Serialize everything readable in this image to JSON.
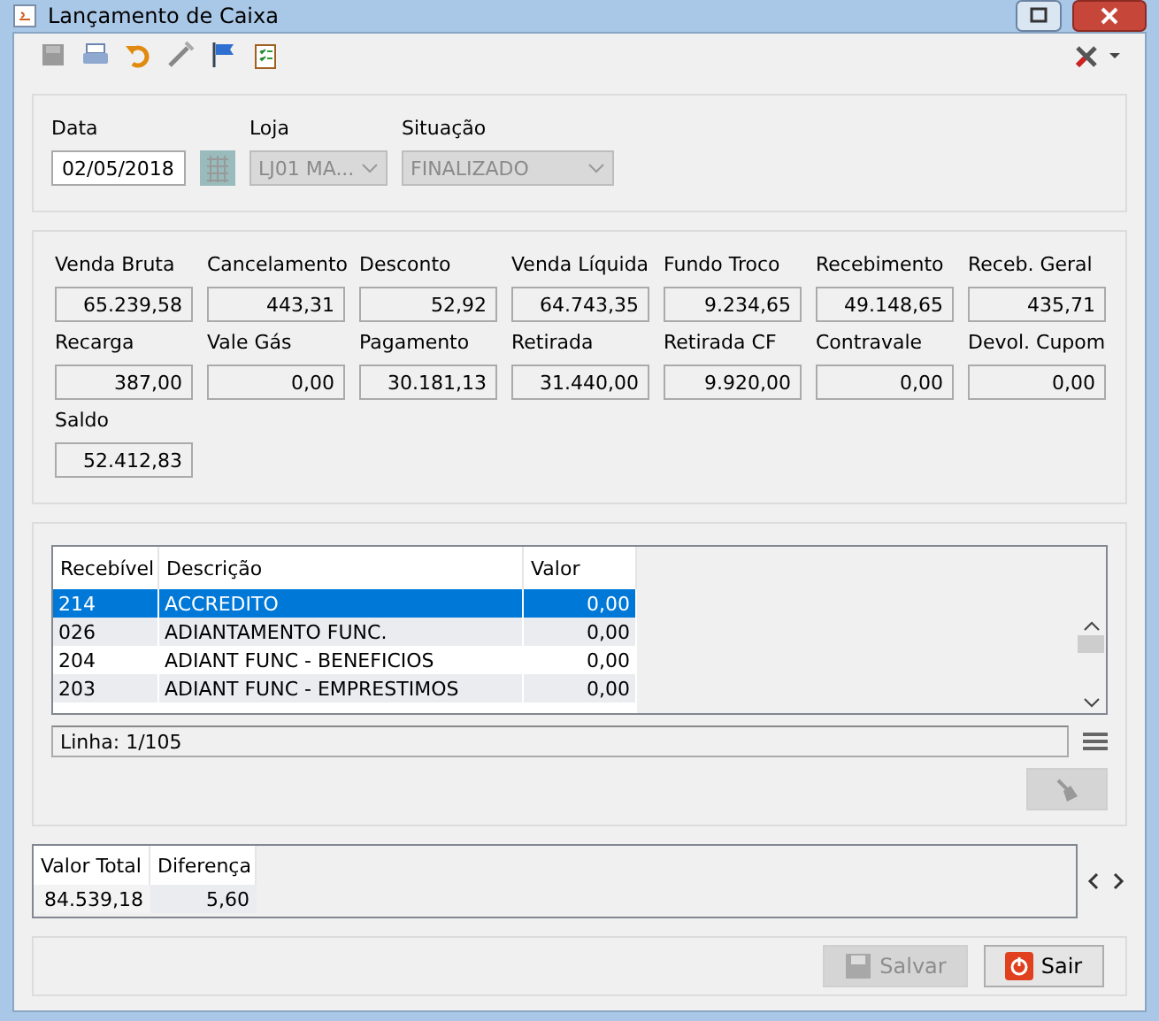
{
  "window": {
    "title": "Lançamento de Caixa"
  },
  "header": {
    "fields": [
      {
        "kind": "date",
        "label": "Data",
        "value": "02/05/2018",
        "disabled": false
      },
      {
        "kind": "combo",
        "label": "Loja",
        "value": "LJ01 MA...",
        "disabled": true
      },
      {
        "kind": "combo",
        "label": "Situação",
        "value": "FINALIZADO",
        "disabled": true
      }
    ]
  },
  "totals": [
    {
      "label": "Venda Bruta",
      "value": "65.239,58"
    },
    {
      "label": "Cancelamento",
      "value": "443,31"
    },
    {
      "label": "Desconto",
      "value": "52,92"
    },
    {
      "label": "Venda Líquida",
      "value": "64.743,35"
    },
    {
      "label": "Fundo Troco",
      "value": "9.234,65"
    },
    {
      "label": "Recebimento",
      "value": "49.148,65"
    },
    {
      "label": "Receb. Geral",
      "value": "435,71"
    },
    {
      "label": "Recarga",
      "value": "387,00"
    },
    {
      "label": "Vale Gás",
      "value": "0,00"
    },
    {
      "label": "Pagamento",
      "value": "30.181,13"
    },
    {
      "label": "Retirada",
      "value": "31.440,00"
    },
    {
      "label": "Retirada CF",
      "value": "9.920,00"
    },
    {
      "label": "Contravale",
      "value": "0,00"
    },
    {
      "label": "Devol. Cupom",
      "value": "0,00"
    },
    {
      "label": "Saldo",
      "value": "52.412,83"
    }
  ],
  "table": {
    "columns": [
      "Recebível",
      "Descrição",
      "Valor"
    ],
    "rows": [
      {
        "cells": [
          "214",
          "ACCREDITO",
          "0,00"
        ],
        "selected": true
      },
      {
        "cells": [
          "026",
          "ADIANTAMENTO FUNC.",
          "0,00"
        ],
        "selected": false
      },
      {
        "cells": [
          "204",
          "ADIANT FUNC - BENEFICIOS",
          "0,00"
        ],
        "selected": false
      },
      {
        "cells": [
          "203",
          "ADIANT FUNC - EMPRESTIMOS",
          "0,00"
        ],
        "selected": false
      }
    ],
    "status": "Linha: 1/105"
  },
  "summary": {
    "columns": [
      "Valor Total",
      "Diferença"
    ],
    "values": [
      "84.539,18",
      "5,60"
    ]
  },
  "buttons": [
    {
      "kind": "save",
      "label": "Salvar",
      "disabled": true
    },
    {
      "kind": "exit",
      "label": "Sair",
      "disabled": false
    }
  ]
}
